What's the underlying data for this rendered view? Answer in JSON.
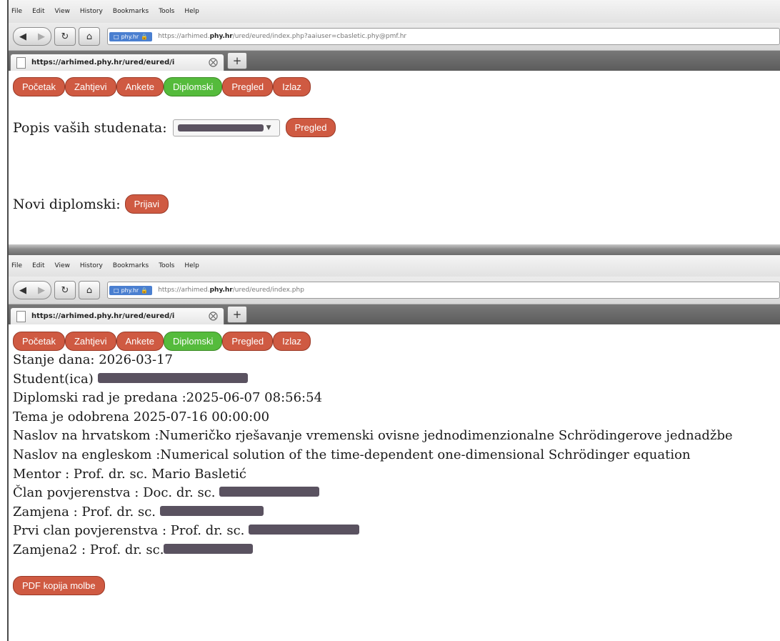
{
  "menu": [
    "File",
    "Edit",
    "View",
    "History",
    "Bookmarks",
    "Tools",
    "Help"
  ],
  "window1": {
    "site_badge": "phy.hr",
    "url_prefix": "https://arhimed.",
    "url_domain": "phy.hr",
    "url_suffix": "/ured/eured/index.php?aaiuser=cbasletic.phy@pmf.hr",
    "tab_title": "https://arhimed.phy.hr/ured/eured/i",
    "nav_buttons": [
      "Početak",
      "Zahtjevi",
      "Ankete",
      "Diplomski",
      "Pregled",
      "Izlaz"
    ],
    "students_label": "Popis vaših studenata:",
    "pregled_button": "Pregled",
    "new_thesis_label": "Novi diplomski:",
    "prijavi_button": "Prijavi"
  },
  "window2": {
    "site_badge": "phy.hr",
    "url_prefix": "https://arhimed.",
    "url_domain": "phy.hr",
    "url_suffix": "/ured/eured/index.php",
    "tab_title": "https://arhimed.phy.hr/ured/eured/i",
    "nav_buttons": [
      "Početak",
      "Zahtjevi",
      "Ankete",
      "Diplomski",
      "Pregled",
      "Izlaz"
    ],
    "lines": {
      "stanje": "Stanje dana: 2026-03-17",
      "student": "Student(ica)",
      "predana": "Diplomski rad je predana :2025-06-07 08:56:54",
      "tema": "Tema je odobrena 2025-07-16 00:00:00",
      "naslov_hr": "Naslov na hrvatskom :Numeričko rješavanje vremenski ovisne jednodimenzionalne Schrödingerove jednadžbe",
      "naslov_en": "Naslov na engleskom :Numerical solution of the time-dependent one-dimensional Schrödinger equation",
      "mentor": "Mentor : Prof. dr. sc. Mario Basletić",
      "clan": "Član povjerenstva : Doc. dr. sc.",
      "zamjena": "Zamjena : Prof. dr. sc.",
      "prvi_clan": "Prvi clan povjerenstva : Prof. dr. sc.",
      "zamjena2": "Zamjena2 : Prof. dr. sc."
    },
    "pdf_button": "PDF kopija molbe"
  },
  "colors": {
    "button_red": "#cf5a42",
    "button_green": "#55bb3c"
  }
}
